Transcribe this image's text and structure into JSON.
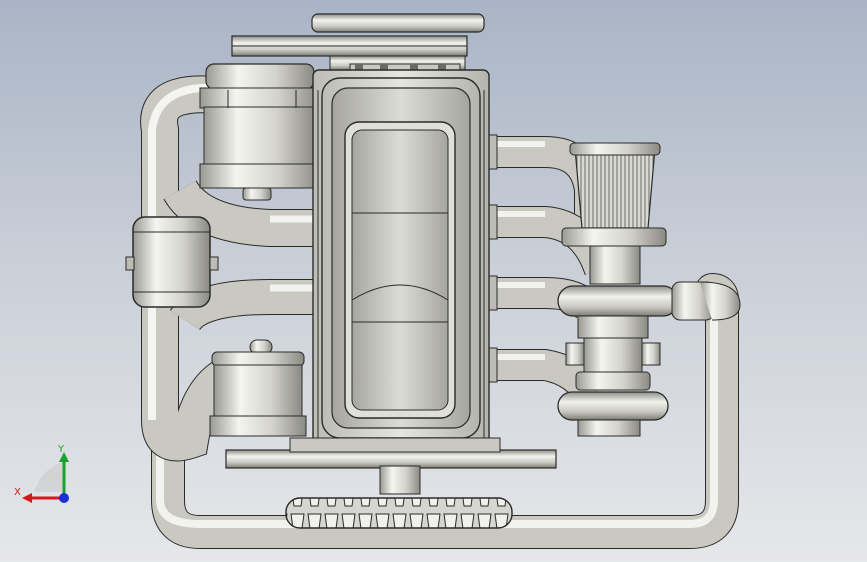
{
  "viewport": {
    "background_top": "#a9b4c6",
    "background_bottom": "#e6e7ea"
  },
  "triad": {
    "x_label": "X",
    "y_label": "Y",
    "x_color": "#d21a1a",
    "y_color": "#1aa32b",
    "z_color": "#1b2fd6"
  },
  "model": {
    "metal_light": "#f2f2ee",
    "metal_mid": "#c9c9c2",
    "metal_dark": "#8f8f88",
    "edge": "#2a2a2a",
    "icon": "engine-assembly-icon"
  }
}
